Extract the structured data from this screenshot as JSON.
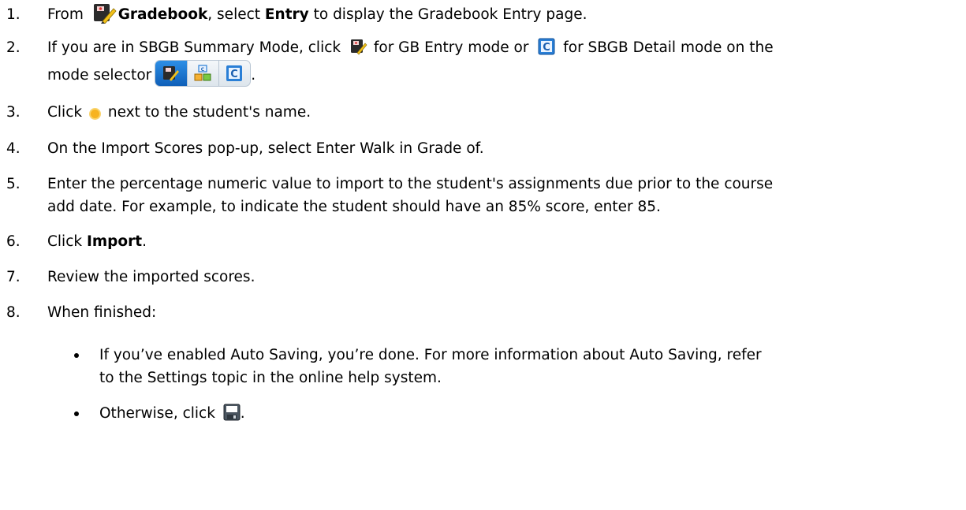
{
  "steps": [
    {
      "num": "1.",
      "pre": "From ",
      "gradebook": "Gradebook",
      "mid": ", select ",
      "entry": "Entry",
      "post": " to display the ",
      "page_link": "Gradebook Entry page",
      "end": "."
    },
    {
      "num": "2.",
      "pre": "If you are in ",
      "mode_link": "SBGB Summary Mode",
      "click": ", click ",
      "gb_entry": " for GB Entry mode or ",
      "sbgb_detail": " for SBGB Detail mode on the",
      "line2": "mode selector",
      "end": "."
    },
    {
      "num": "3.",
      "pre": "Click ",
      "post": " next to the student's name."
    },
    {
      "num": "4.",
      "text": "On the Import Scores pop-up, select Enter Walk in Grade of."
    },
    {
      "num": "5.",
      "line1": "Enter the percentage numeric value to import to the student's assignments due prior to the course",
      "line2": "add date. For example, to indicate the student should have an 85% score, enter 85."
    },
    {
      "num": "6.",
      "pre": "Click ",
      "bold": "Import",
      "end": "."
    },
    {
      "num": "7.",
      "text": "Review the imported scores."
    },
    {
      "num": "8.",
      "text": "When finished:"
    }
  ],
  "bullets": [
    {
      "pre": "If you’ve enabled ",
      "link": "Auto Saving",
      "post": ", you’re done. For more information about Auto Saving, refer",
      "line2": "to the Settings topic in the online help system."
    },
    {
      "pre": "Otherwise, click ",
      "end": "."
    }
  ],
  "icons": {
    "gradebook": "gradebook-pencil-icon",
    "sbgb_detail": "sbgb-detail-c-icon",
    "gradebook_mode_sbgb_summary": "sbgb-summary-grid-icon",
    "sun": "sun-icon",
    "save": "floppy-save-icon"
  },
  "colors": {
    "text": "#000000",
    "accent_blue": "#1a6fd1",
    "sun": "#f7b31f"
  }
}
